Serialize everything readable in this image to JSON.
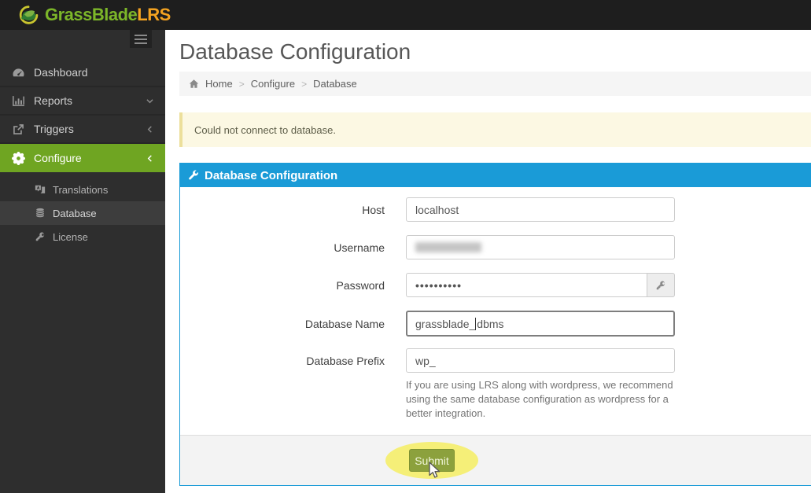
{
  "topbar": {
    "logo_primary": "GrassBlade",
    "logo_secondary": "LRS"
  },
  "sidebar": {
    "items": [
      {
        "label": "Dashboard",
        "icon": "dashboard-icon"
      },
      {
        "label": "Reports",
        "icon": "bar-chart-icon",
        "chevron": "down"
      },
      {
        "label": "Triggers",
        "icon": "external-link-icon",
        "chevron": "left"
      },
      {
        "label": "Configure",
        "icon": "gear-icon",
        "chevron": "left",
        "active": true
      }
    ],
    "submenu": [
      {
        "label": "Translations",
        "icon": "language-icon"
      },
      {
        "label": "Database",
        "icon": "database-icon",
        "active": true
      },
      {
        "label": "License",
        "icon": "key-icon"
      }
    ]
  },
  "page": {
    "title": "Database Configuration"
  },
  "breadcrumb": {
    "separator": ">",
    "items": [
      "Home",
      "Configure",
      "Database"
    ]
  },
  "alert": {
    "message": "Could not connect to database."
  },
  "panel": {
    "title": "Database Configuration",
    "fields": {
      "host": {
        "label": "Host",
        "value": "localhost"
      },
      "username": {
        "label": "Username",
        "value_redacted": "(blurred)"
      },
      "password": {
        "label": "Password",
        "value_masked": "••••••••••"
      },
      "database_name": {
        "label": "Database Name",
        "value_pre_caret": "grassblade_",
        "value_post_caret": "dbms"
      },
      "database_prefix": {
        "label": "Database Prefix",
        "value": "wp_",
        "help": "If you are using LRS along with wordpress, we recommend using the same database configuration as wordpress for a better integration."
      }
    },
    "submit_label": "Submit"
  },
  "colors": {
    "topbar_bg": "#1e1e1e",
    "sidebar_bg": "#2e2e2e",
    "active_menu_green": "#6fa522",
    "panel_blue": "#1a9bd7",
    "alert_bg": "#fcf8e3",
    "alert_border": "#ecdf9b",
    "submit_green": "#8ca13d",
    "highlight_yellow": "#f4ed62",
    "logo_green": "#7cb629",
    "logo_orange": "#f4a321"
  }
}
